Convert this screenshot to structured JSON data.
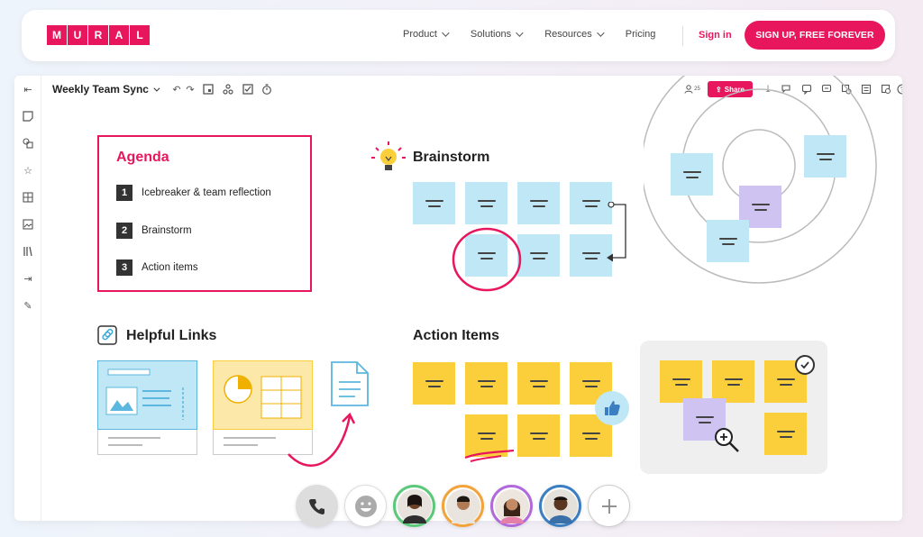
{
  "logo": {
    "letters": [
      "M",
      "U",
      "R",
      "A",
      "L"
    ],
    "brand_color": "#e8175d"
  },
  "nav": {
    "links": [
      "Product",
      "Solutions",
      "Resources",
      "Pricing"
    ],
    "sign_in": "Sign in",
    "cta": "SIGN UP, FREE FOREVER"
  },
  "toolbar": {
    "board_title": "Weekly Team Sync",
    "collaborators_count": "25",
    "share_label": "Share"
  },
  "agenda": {
    "title": "Agenda",
    "items": [
      {
        "num": "1",
        "label": "Icebreaker & team reflection"
      },
      {
        "num": "2",
        "label": "Brainstorm"
      },
      {
        "num": "3",
        "label": "Action items"
      }
    ]
  },
  "sections": {
    "brainstorm": "Brainstorm",
    "helpful_links": "Helpful Links",
    "action_items": "Action Items"
  },
  "colors": {
    "accent": "#e8175d",
    "note_blue": "#bfe7f5",
    "note_yellow": "#fbcf3b",
    "note_purple": "#cfc4f1"
  }
}
